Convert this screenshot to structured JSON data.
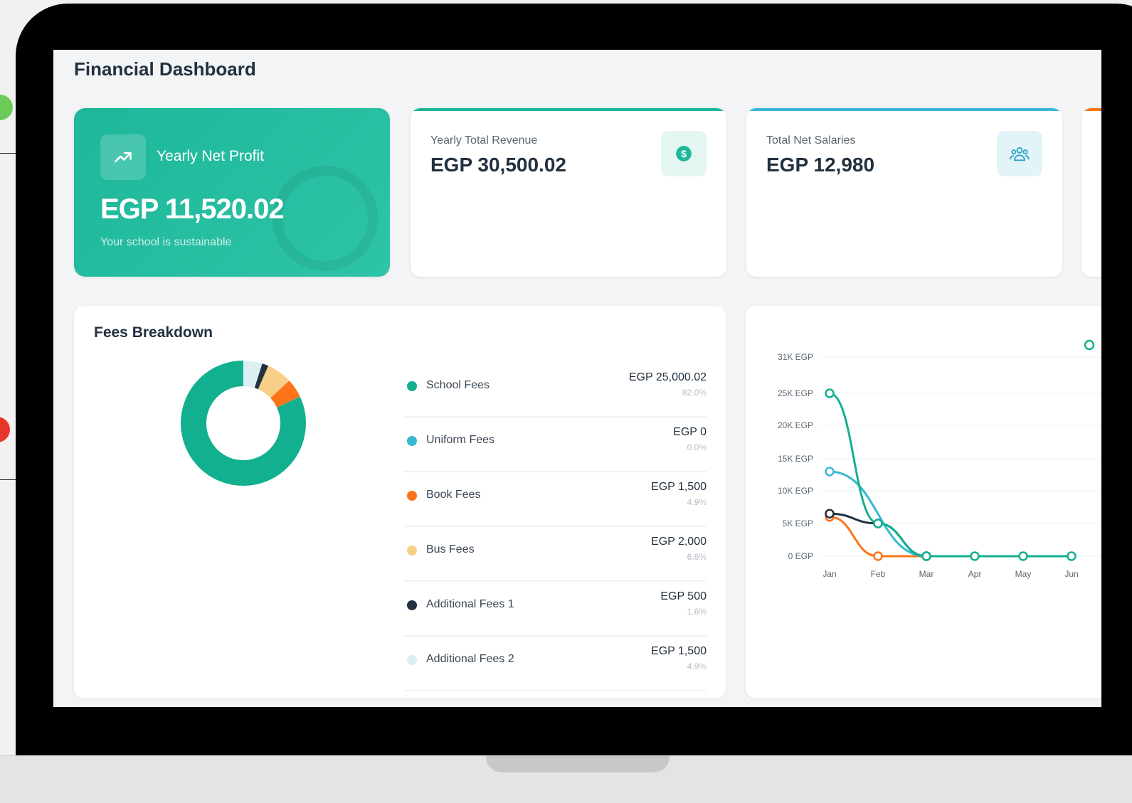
{
  "title": "Financial Dashboard",
  "colors": {
    "accent": "#1eb79a",
    "text": "#22303f"
  },
  "net_profit": {
    "label": "Yearly Net Profit",
    "value": "EGP 11,520.02",
    "sub": "Your school is sustainable",
    "icon": "trending-up-icon"
  },
  "revenue": {
    "label": "Yearly Total Revenue",
    "value": "EGP 30,500.02",
    "icon": "dollar-circle-icon",
    "color": "#1eb79a"
  },
  "salaries": {
    "label": "Total Net Salaries",
    "value": "EGP 12,980",
    "icon": "users-icon",
    "color": "#3bb8d3"
  },
  "fees": {
    "title": "Fees Breakdown",
    "items": [
      {
        "label": "School Fees",
        "amount": "EGP 25,000.02",
        "pct": "82.0%",
        "color": "#13b08f",
        "value": 25000.02
      },
      {
        "label": "Uniform Fees",
        "amount": "EGP 0",
        "pct": "0.0%",
        "color": "#36b9cf",
        "value": 0
      },
      {
        "label": "Book Fees",
        "amount": "EGP 1,500",
        "pct": "4.9%",
        "color": "#fb7419",
        "value": 1500
      },
      {
        "label": "Bus Fees",
        "amount": "EGP 2,000",
        "pct": "6.6%",
        "color": "#f8cf87",
        "value": 2000
      },
      {
        "label": "Additional Fees 1",
        "amount": "EGP 500",
        "pct": "1.6%",
        "color": "#22303f",
        "value": 500
      },
      {
        "label": "Additional Fees 2",
        "amount": "EGP 1,500",
        "pct": "4.9%",
        "color": "#dcf0f4",
        "value": 1500
      }
    ]
  },
  "chart_data": {
    "type": "line",
    "x": [
      "Jan",
      "Feb",
      "Mar",
      "Apr",
      "May",
      "Jun"
    ],
    "y_ticks": [
      "0 EGP",
      "5K EGP",
      "10K EGP",
      "15K EGP",
      "20K EGP",
      "25K EGP",
      "31K EGP"
    ],
    "ylim": [
      0,
      31000
    ],
    "series": [
      {
        "color": "#13b08f",
        "values": [
          25000,
          5000,
          0,
          0,
          0,
          0
        ]
      },
      {
        "color": "#36b9cf",
        "values": [
          13000,
          null,
          0,
          null,
          null,
          null
        ]
      },
      {
        "color": "#22303f",
        "values": [
          6500,
          5000,
          0,
          null,
          null,
          null
        ]
      },
      {
        "color": "#fb7419",
        "values": [
          6000,
          0,
          0,
          null,
          null,
          null
        ]
      }
    ]
  }
}
